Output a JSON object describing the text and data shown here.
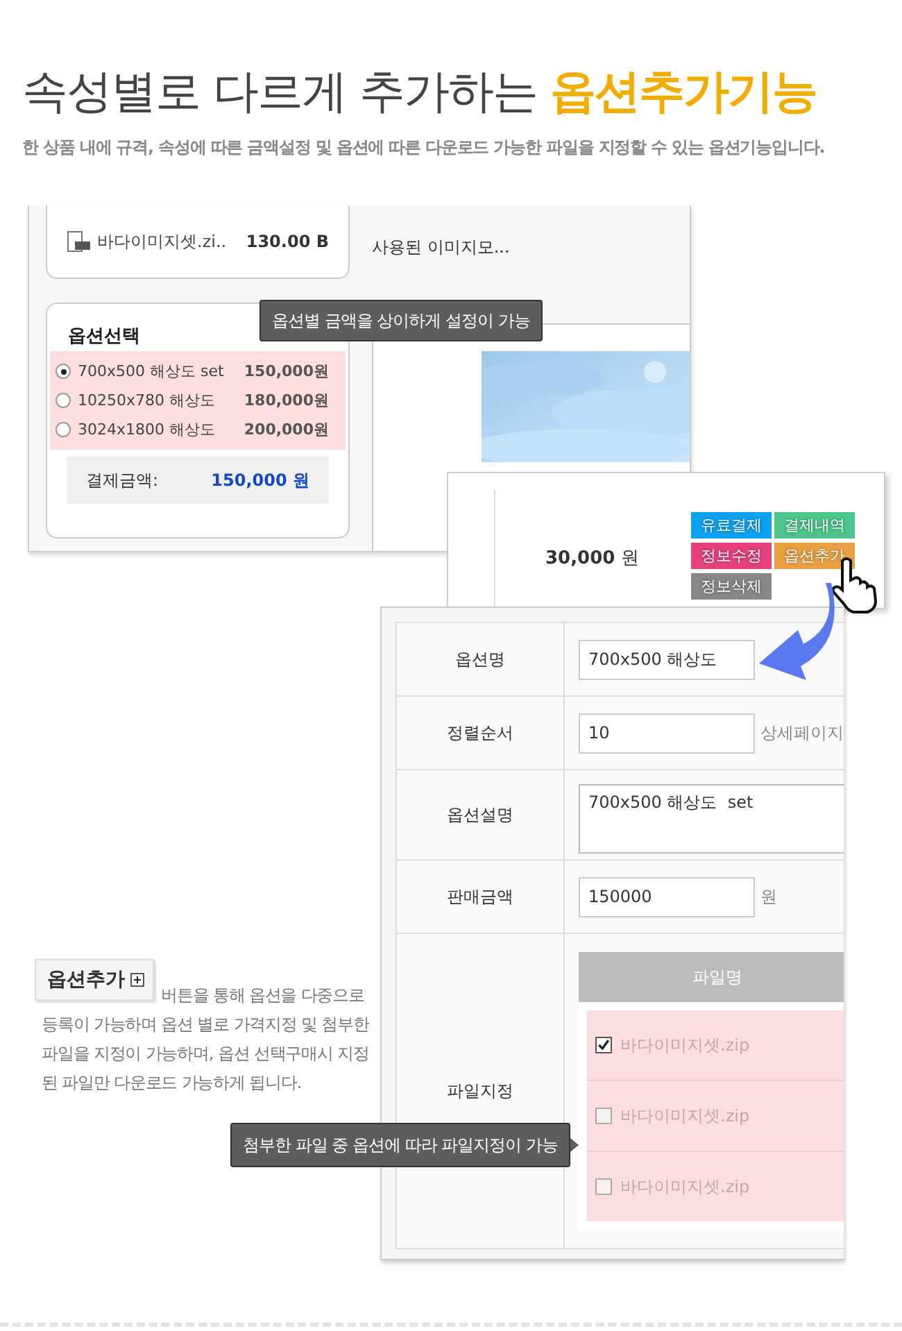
{
  "heading": {
    "text": "속성별로 다르게 추가하는",
    "highlight": "옵션추가기능"
  },
  "subtitle": "한 상품 내에 규격, 속성에 따른 금액설정 및 옵션에 따른 다운로드 가능한 파일을 지정할 수 있는 옵션기능입니다.",
  "product_panel": {
    "files": [
      {
        "name": "바다이미지셋.zi..",
        "size": "130.00 B"
      }
    ],
    "description": "사용된 이미지모...",
    "option_select": {
      "title": "옵션선택",
      "options": [
        {
          "label": "700x500 해상도 set",
          "price": "150,000원",
          "selected": true
        },
        {
          "label": "10250x780 해상도",
          "price": "180,000원",
          "selected": false
        },
        {
          "label": "3024x1800 해상도",
          "price": "200,000원",
          "selected": false
        }
      ],
      "total_label": "결제금액:",
      "total_value": "150,000 원"
    }
  },
  "tooltips": [
    "옵션별 금액을 상이하게 설정이 가능",
    "첨부한 파일 중 옵션에 따라  파일지정이 가능"
  ],
  "admin_row": {
    "price": "30,000",
    "unit": "원",
    "buttons": [
      {
        "label": "유료결제",
        "color": "#0ba2f2"
      },
      {
        "label": "결제내역",
        "color": "#4cc58d"
      },
      {
        "label": "정보수정",
        "color": "#e6417e"
      },
      {
        "label": "옵션추가",
        "color": "#e9a043"
      },
      {
        "label": "정보삭제",
        "color": "#888888"
      }
    ]
  },
  "option_form": {
    "rows": [
      {
        "kind": "input",
        "label": "옵션명",
        "value": "700x500 해상도"
      },
      {
        "kind": "input",
        "label": "정렬순서",
        "value": "10",
        "note": "상세페이지"
      },
      {
        "kind": "textarea",
        "label": "옵션설명",
        "value": "700x500 해상도  set"
      },
      {
        "kind": "input",
        "label": "판매금액",
        "value": "150000",
        "note": "원"
      },
      {
        "kind": "files",
        "label": "파일지정",
        "column": "파일명",
        "files": [
          {
            "name": "바다이미지셋.zip",
            "checked": true
          },
          {
            "name": "바다이미지셋.zip",
            "checked": false
          },
          {
            "name": "바다이미지셋.zip",
            "checked": false
          }
        ]
      }
    ]
  },
  "explainer": {
    "button": "옵션추가",
    "text": "버튼을 통해 옵션을 다중으로 등록이 가능하며 옵션 별로 가격지정 및 첨부한 파일을 지정이 가능하며, 옵션 선택구매시 지정된 파일만 다운로드 가능하게 됩니다."
  }
}
